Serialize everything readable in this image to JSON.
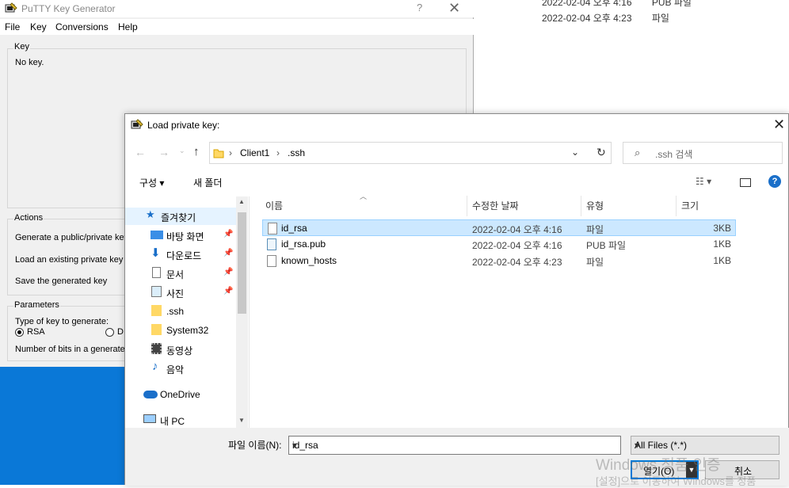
{
  "background_rows": [
    {
      "date": "2022-02-04 오후 4:16",
      "type": "PUB 파일"
    },
    {
      "date": "2022-02-04 오후 4:23",
      "type": "파일"
    }
  ],
  "putty": {
    "title": "PuTTY Key Generator",
    "help_btn": "?",
    "close_btn": "✕",
    "menu": [
      "File",
      "Key",
      "Conversions",
      "Help"
    ],
    "key_group": "Key",
    "no_key": "No key.",
    "actions_group": "Actions",
    "actions": [
      "Generate a public/private key",
      "Load an existing private key f",
      "Save the generated key"
    ],
    "params_group": "Parameters",
    "type_label": "Type of key to generate:",
    "radio_rsa": "RSA",
    "radio_d": "D",
    "bits_label": "Number of bits in a generated"
  },
  "dialog": {
    "title": "Load private key:",
    "close": "✕",
    "breadcrumb": [
      "Client1",
      ".ssh"
    ],
    "search_placeholder": ".ssh 검색",
    "toolbar": {
      "organize": "구성 ▾",
      "new_folder": "새 폴더"
    },
    "nav_items": [
      {
        "label": "즐겨찾기",
        "icon": "star-icon"
      },
      {
        "label": "바탕 화면",
        "icon": "desktop-icon",
        "pinned": true
      },
      {
        "label": "다운로드",
        "icon": "download-icon",
        "pinned": true
      },
      {
        "label": "문서",
        "icon": "document-icon",
        "pinned": true
      },
      {
        "label": "사진",
        "icon": "picture-icon",
        "pinned": true
      },
      {
        "label": ".ssh",
        "icon": "folder-icon"
      },
      {
        "label": "System32",
        "icon": "folder-icon"
      },
      {
        "label": "동영상",
        "icon": "video-icon"
      },
      {
        "label": "음악",
        "icon": "music-icon"
      },
      {
        "label": "OneDrive",
        "icon": "cloud-icon"
      },
      {
        "label": "내 PC",
        "icon": "pc-icon"
      }
    ],
    "columns": [
      "이름",
      "수정한 날짜",
      "유형",
      "크기"
    ],
    "files": [
      {
        "name": "id_rsa",
        "date": "2022-02-04 오후 4:16",
        "type": "파일",
        "size": "3KB",
        "selected": true
      },
      {
        "name": "id_rsa.pub",
        "date": "2022-02-04 오후 4:16",
        "type": "PUB 파일",
        "size": "1KB",
        "selected": false
      },
      {
        "name": "known_hosts",
        "date": "2022-02-04 오후 4:23",
        "type": "파일",
        "size": "1KB",
        "selected": false
      }
    ],
    "filename_label": "파일 이름(N):",
    "filename_value": "id_rsa",
    "filter_value": "All Files (*.*)",
    "open_label": "열기(O)",
    "cancel_label": "취소"
  },
  "watermark": {
    "line1": "Windows 정품 인증",
    "line2": "[설정]으로 이동하여 Windows를 정품"
  }
}
